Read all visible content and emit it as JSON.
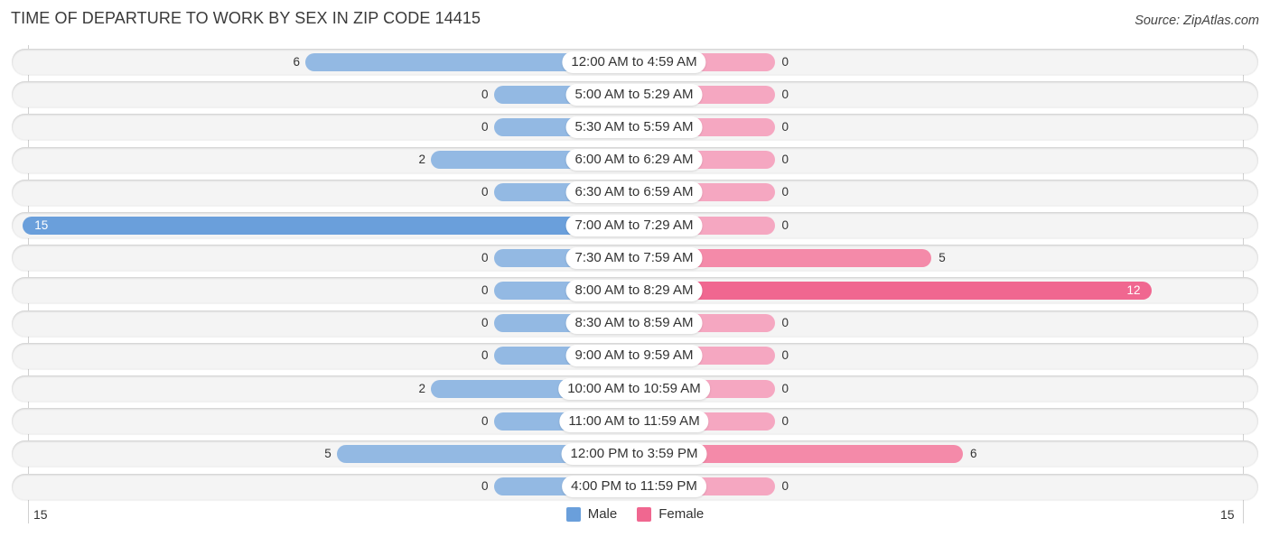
{
  "chart_data": {
    "type": "bar",
    "orientation": "horizontal-diverging",
    "title": "TIME OF DEPARTURE TO WORK BY SEX IN ZIP CODE 14415",
    "source": "Source: ZipAtlas.com",
    "categories": [
      "12:00 AM to 4:59 AM",
      "5:00 AM to 5:29 AM",
      "5:30 AM to 5:59 AM",
      "6:00 AM to 6:29 AM",
      "6:30 AM to 6:59 AM",
      "7:00 AM to 7:29 AM",
      "7:30 AM to 7:59 AM",
      "8:00 AM to 8:29 AM",
      "8:30 AM to 8:59 AM",
      "9:00 AM to 9:59 AM",
      "10:00 AM to 10:59 AM",
      "11:00 AM to 11:59 AM",
      "12:00 PM to 3:59 PM",
      "4:00 PM to 11:59 PM"
    ],
    "series": [
      {
        "name": "Male",
        "color": "#6a9fdb",
        "values": [
          6,
          0,
          0,
          2,
          0,
          15,
          0,
          0,
          0,
          0,
          2,
          0,
          5,
          0
        ]
      },
      {
        "name": "Female",
        "color": "#f06790",
        "values": [
          0,
          0,
          0,
          0,
          0,
          0,
          5,
          12,
          0,
          0,
          0,
          0,
          6,
          0
        ]
      }
    ],
    "axis": {
      "left_tick": "15",
      "right_tick": "15",
      "range": [
        15,
        15
      ]
    },
    "legend": {
      "position": "bottom-center",
      "items": [
        "Male",
        "Female"
      ]
    },
    "grid": false
  }
}
